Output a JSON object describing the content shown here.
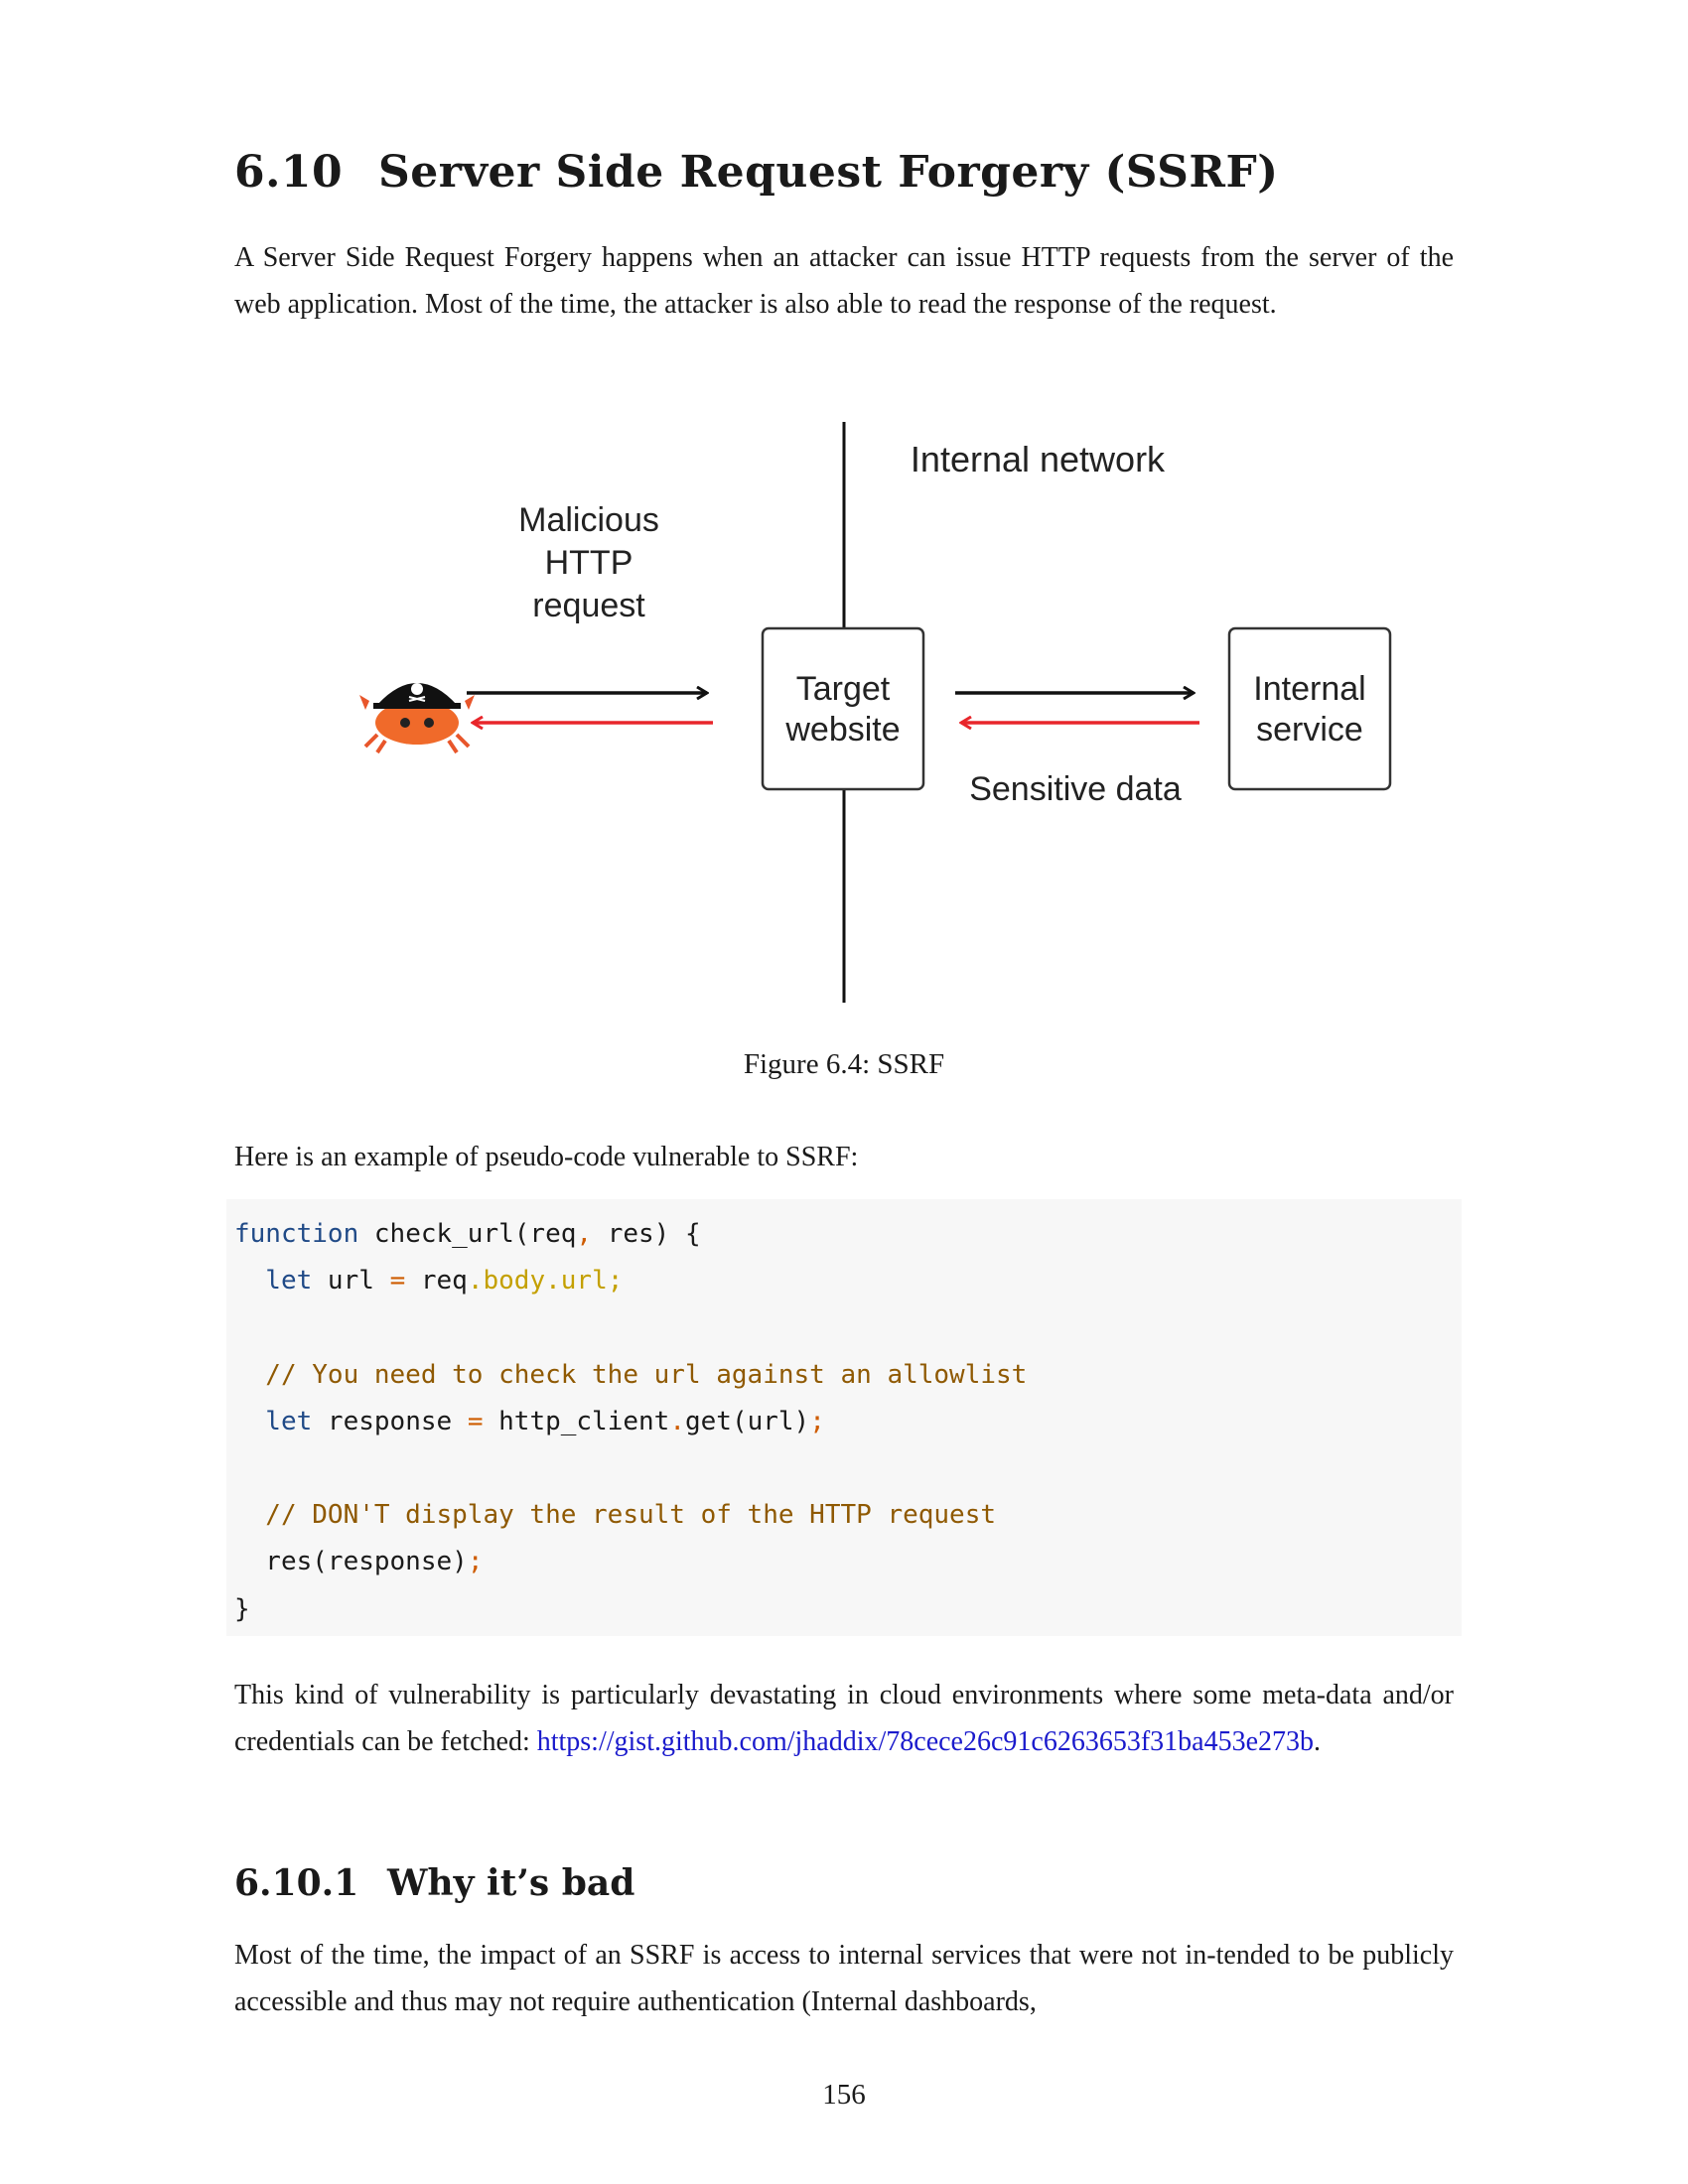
{
  "section": {
    "number": "6.10",
    "title": "Server Side Request Forgery (SSRF)"
  },
  "intro": "A Server Side Request Forgery happens when an attacker can issue HTTP requests from the server of the web application. Most of the time, the attacker is also able to read the response of the request.",
  "figure": {
    "label_internal_network": "Internal network",
    "label_malicious_line1": "Malicious",
    "label_malicious_line2": "HTTP",
    "label_malicious_line3": "request",
    "label_target_line1": "Target",
    "label_target_line2": "website",
    "label_internal_line1": "Internal",
    "label_internal_line2": "service",
    "label_sensitive": "Sensitive data",
    "request_color": "#111111",
    "response_color": "#e8262b",
    "attacker_icon": "pirate-crab-icon",
    "caption": "Figure 6.4: SSRF"
  },
  "lead": "Here is an example of pseudo-code vulnerable to SSRF:",
  "code": {
    "l1_kw": "function",
    "l1_a": " check_url(req",
    "l1_op": ",",
    "l1_b": " res) {",
    "l2_kw": "  let",
    "l2_a": " url ",
    "l2_op": "=",
    "l2_b": " req",
    "l2_fld": ".body.url;",
    "l4_cm": "  // You need to check the url against an allowlist",
    "l5_kw": "  let",
    "l5_a": " response ",
    "l5_op": "=",
    "l5_b": " http_client",
    "l5_op2": ".",
    "l5_c": "get(url)",
    "l5_op3": ";",
    "l7_cm": "  // DON'T display the result of the HTTP request",
    "l8_a": "  res(response)",
    "l8_op": ";",
    "l9": "}"
  },
  "cloud": {
    "text": "This kind of vulnerability is particularly devastating in cloud environments where some meta-data and/or credentials can be fetched: ",
    "link": "https://gist.github.com/jhaddix/78cece26c91c6263653f31ba453e273b",
    "end": "."
  },
  "subsection": {
    "number": "6.10.1",
    "title": "Why it’s bad"
  },
  "why": "Most of the time, the impact of an SSRF is access to internal services that were not in-tended to be publicly accessible and thus may not require authentication (Internal dashboards,",
  "page_number": "156"
}
